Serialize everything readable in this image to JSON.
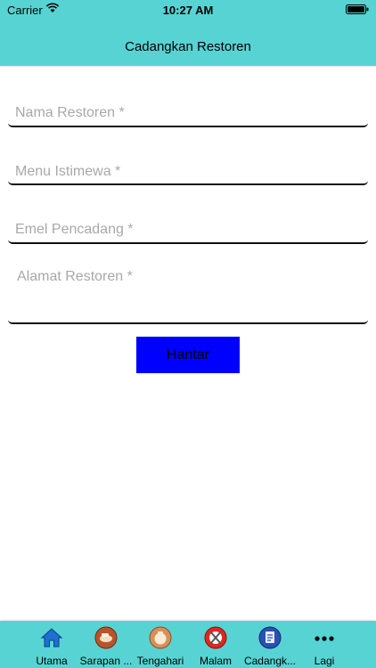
{
  "status_bar": {
    "carrier": "Carrier",
    "time": "10:27 AM"
  },
  "nav": {
    "title": "Cadangkan Restoren"
  },
  "form": {
    "fields": [
      {
        "placeholder": "Nama Restoren *",
        "value": ""
      },
      {
        "placeholder": "Menu Istimewa *",
        "value": ""
      },
      {
        "placeholder": "Emel Pencadang *",
        "value": ""
      },
      {
        "placeholder": "Alamat Restoren *",
        "value": ""
      }
    ],
    "submit_label": "Hantar",
    "submit_color": "#0000ff"
  },
  "tab_bar": {
    "background": "#58d3d3",
    "tabs": [
      {
        "label": "Utama",
        "icon": "home-icon"
      },
      {
        "label": "Sarapan ...",
        "icon": "breakfast-icon"
      },
      {
        "label": "Tengahari",
        "icon": "lunch-icon"
      },
      {
        "label": "Malam",
        "icon": "dinner-icon"
      },
      {
        "label": "Cadangk...",
        "icon": "suggest-icon"
      },
      {
        "label": "Lagi",
        "icon": "more-icon"
      }
    ]
  }
}
